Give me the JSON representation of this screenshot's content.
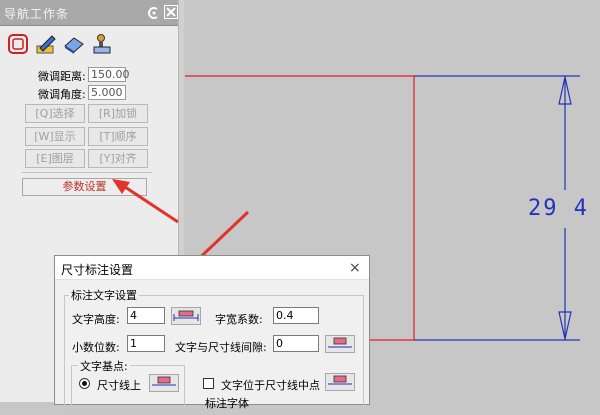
{
  "nav_panel": {
    "title": "导航工作条",
    "toolbar": [
      {
        "icon": "frame-select-icon"
      },
      {
        "icon": "edit-pencil-icon"
      },
      {
        "icon": "eraser-icon"
      },
      {
        "icon": "stamp-icon"
      }
    ],
    "fine_distance_label": "微调距离:",
    "fine_distance_value": "150.00",
    "fine_angle_label": "微调角度:",
    "fine_angle_value": "5.000",
    "buttons": [
      {
        "label": "[Q]选择"
      },
      {
        "label": "[R]加锁"
      },
      {
        "label": "[W]显示"
      },
      {
        "label": "[T]顺序"
      },
      {
        "label": "[E]图层"
      },
      {
        "label": "[Y]对齐"
      }
    ],
    "param_button": "参数设置"
  },
  "drawing": {
    "dimension_text": "29 4",
    "line_color": "#e02020",
    "dim_color": "#2233bb",
    "arrow_color": "#e2332a"
  },
  "dialog": {
    "title": "尺寸标注设置",
    "close_glyph": "×",
    "group_title": "标注文字设置",
    "text_height_label": "文字高度:",
    "text_height_value": "4",
    "width_factor_label": "字宽系数:",
    "width_factor_value": "0.4",
    "decimals_label": "小数位数:",
    "decimals_value": "1",
    "gap_label": "文字与尺寸线间隙:",
    "gap_value": "0",
    "basepoint_group": "文字基点:",
    "radio_on_line": "尺寸线上",
    "checkbox_mid_label": "文字位于尺寸线中点",
    "partial_label": "标注字体"
  }
}
